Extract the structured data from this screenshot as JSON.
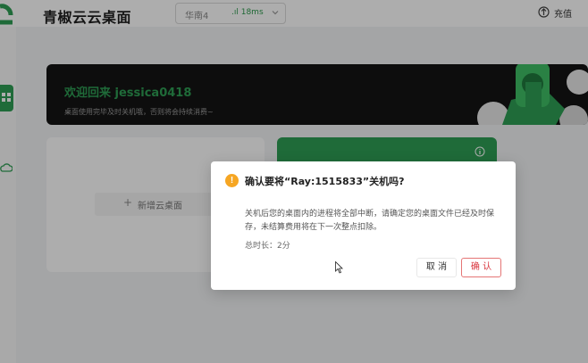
{
  "app": {
    "title": "青椒云云桌面",
    "region": {
      "name": "华南4",
      "latency": ".ıl 18ms"
    },
    "charge_label": "充值"
  },
  "banner": {
    "welcome": "欢迎回来 jessica0418",
    "subtitle": "桌面使用完毕及时关机哦，否则将会持续消费~"
  },
  "add_card": {
    "plus": "+",
    "label": "新增云桌面"
  },
  "dialog": {
    "title": "确认要将“Ray:1515833”关机吗?",
    "body": "关机后您的桌面内的进程将全部中断，请确定您的桌面文件已经及时保存，未结算费用将在下一次整点扣除。",
    "meta": "总时长：2分",
    "cancel_label": "取 消",
    "confirm_label": "确 认"
  },
  "colors": {
    "brand_green": "#2f9e54",
    "warning": "#f6a623",
    "danger": "#d9363e"
  },
  "icons": [
    "app-logo-icon",
    "chevron-down-icon",
    "charge-icon",
    "desktop-icon",
    "cloud-icon",
    "info-icon",
    "warning-icon",
    "cursor-icon"
  ]
}
